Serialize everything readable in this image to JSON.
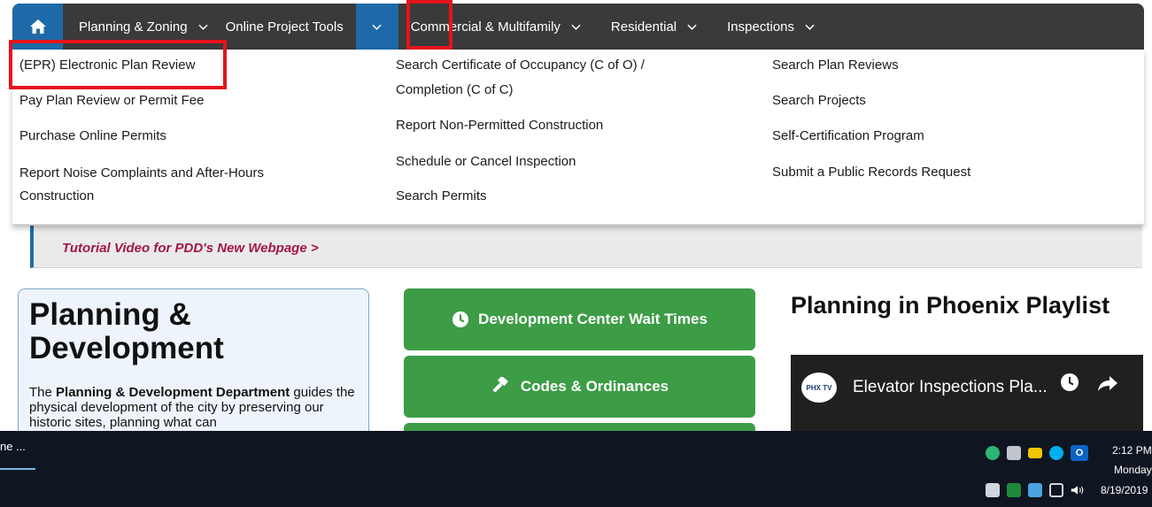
{
  "nav": {
    "items": [
      {
        "label": "Planning & Zoning"
      },
      {
        "label": "Online Project Tools"
      },
      {
        "label": "Commercial & Multifamily"
      },
      {
        "label": "Residential"
      },
      {
        "label": "Inspections"
      }
    ]
  },
  "dropdown": {
    "col1": [
      "(EPR) Electronic Plan Review",
      "Pay Plan Review or Permit Fee",
      "Purchase Online Permits",
      "Report Noise Complaints and After-Hours",
      "Construction"
    ],
    "col2": [
      "Search Certificate of Occupancy (C of O) /",
      "Completion (C of C)",
      "Report Non-Permitted Construction",
      "Schedule or Cancel Inspection",
      "Search Permits"
    ],
    "col3": [
      "Search Plan Reviews",
      "Search Projects",
      "Self-Certification Program",
      "Submit a Public Records Request"
    ]
  },
  "tutorial": {
    "link": "Tutorial Video for PDD's New Webpage >"
  },
  "card": {
    "title": "Planning & Development",
    "body_pre": "The ",
    "body_bold": "Planning & Development Department",
    "body_rest": " guides the physical development of the city by preserving our historic sites, planning what can"
  },
  "buttons": {
    "wait_times": "Development Center Wait Times",
    "codes": "Codes & Ordinances"
  },
  "playlist": {
    "title": "Planning in Phoenix Playlist",
    "video_title": "Elevator Inspections Pla...",
    "logo_text": "PHX TV"
  },
  "taskbar": {
    "app_label": "ne ...",
    "time": "2:12 PM",
    "day": "Monday",
    "date": "8/19/2019",
    "outlook_label": "O"
  },
  "colors": {
    "accent_blue": "#1e6aa8",
    "nav_dark": "#3a3a3a",
    "green": "#3d9c46",
    "highlight_red": "#e5141b",
    "link_magenta": "#a3154a"
  }
}
